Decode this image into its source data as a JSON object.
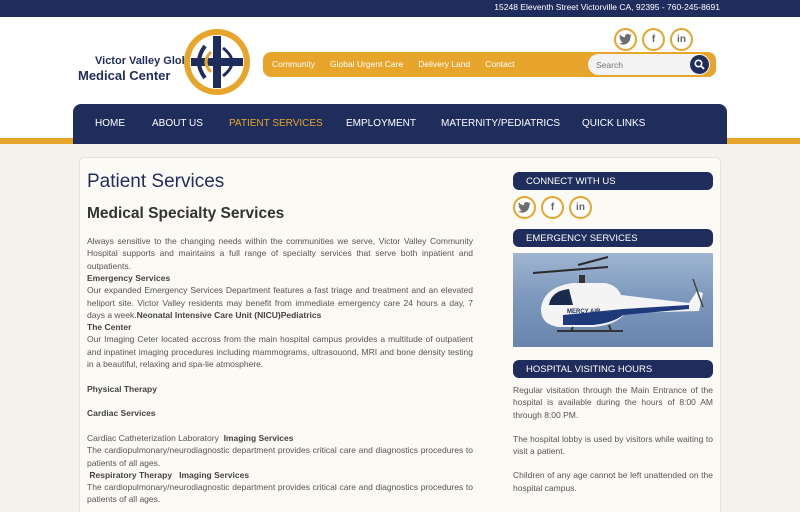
{
  "topbar": {
    "address": "15248 Eleventh Street Victorville CA, 92395 - 760-245-8691"
  },
  "logo": {
    "line1": "Victor Valley Global",
    "line2": "Medical Center"
  },
  "social": {
    "twitter": "t",
    "facebook": "f",
    "linkedin": "in"
  },
  "quicknav": {
    "links": [
      "Community",
      "Global Urgent Care",
      "Delivery Land",
      "Contact"
    ]
  },
  "search": {
    "placeholder": "Search"
  },
  "mainnav": {
    "items": [
      "HOME",
      "ABOUT US",
      "PATIENT SERVICES",
      "EMPLOYMENT",
      "MATERNITY/PEDIATRICS",
      "QUICK LINKS"
    ],
    "active": "PATIENT SERVICES"
  },
  "main": {
    "title": "Patient Services",
    "subtitle": "Medical Specialty Services",
    "intro": "Always sensitive to the changing needs within the communities we serve, Victor Valley Community Hospital supports and maintains a full range of specialty services that serve both inpatient and outpatients.",
    "emergency_heading": "Emergency Services",
    "emergency_text": "Our expanded Emergency Services Department features a fast triage and treatment and an elevated heliport site. Victor Valley residents may benefit from immediate emergency care 24 hours a day, 7 days a week.",
    "nicu": "Neonatal Intensive Care Unit (NICU)",
    "pediatrics": "Pediatrics",
    "center_heading": "The Center",
    "center_text": "Our Imaging Ceter located accross from the main hospital campus provides a multitude of outpatient and inpatinet imaging procedures including mammograms, ultrasouond, MRI and bone density testing in a beautiful, relaxing and spa-lie atmosphere.",
    "physical_therapy": "Physical Therapy",
    "cardiac_services": "Cardiac Services",
    "cath_lab": "Cardiac Catheterization Laboratory",
    "imaging_services": "Imaging Services",
    "cardio_text_1": "The cardiopulmonary/neurodiagnostic department provides critical care and diagnostics procedures to patients of all ages.",
    "respiratory": "Respiratory Therapy",
    "imaging_services_2": "Imaging Services",
    "cardio_text_2": "The cardiopulmonary/neurodiagnostic department provides critical care and diagnostics procedures to patients of all ages."
  },
  "sidebar": {
    "connect_title": "CONNECT WITH US",
    "emergency_title": "EMERGENCY SERVICES",
    "helicopter_text": "MERCY AIR",
    "visiting_title": "HOSPITAL VISITING HOURS",
    "visiting_p1": "Regular visitation through the Main Entrance of the hospital is available during the hours of 8:00 AM through 8:00 PM.",
    "visiting_p2": "The hospital lobby is used by visitors while waiting to visit a patient.",
    "visiting_p3": "Children of any age cannot be left unattended on the hospital campus."
  },
  "colors": {
    "navy": "#1f2d5c",
    "gold": "#e8a52c",
    "content_bg": "#f4f2ed"
  }
}
